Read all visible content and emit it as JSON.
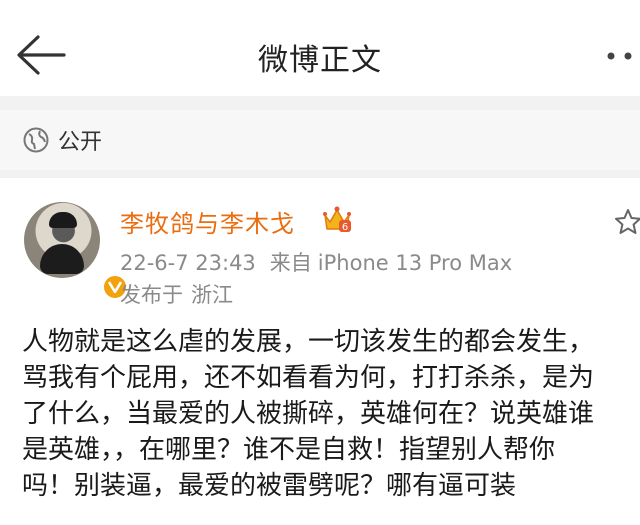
{
  "navbar": {
    "title": "微博正文",
    "back_icon": "arrow-left-icon",
    "more_icon": "more-dots-icon"
  },
  "visibility": {
    "icon": "globe-icon",
    "label": "公开"
  },
  "post": {
    "author": {
      "name": "李牧鸽与李木戈",
      "badge_icon": "crown-icon",
      "verified_icon": "vip-v-icon"
    },
    "time": "22-6-7 23:43",
    "source_prefix": "来自",
    "source": "iPhone 13 Pro Max",
    "location_prefix": "发布于",
    "location": "浙江",
    "text_lines": [
      "人物就是这么虐的发展，一切该发生的都会发生，",
      "骂我有个屁用，还不如看看为何，打打杀杀，是为",
      "了什么，当最爱的人被撕碎，英雄何在？说英雄谁",
      "是英雄，，在哪里？谁不是自救！指望别人帮你",
      "吗！别装逼，最爱的被雷劈呢？哪有逼可装"
    ]
  },
  "colors": {
    "username": "#ea6d12",
    "meta_gray": "#8a8a8a",
    "separator": "#f2f2f2"
  }
}
